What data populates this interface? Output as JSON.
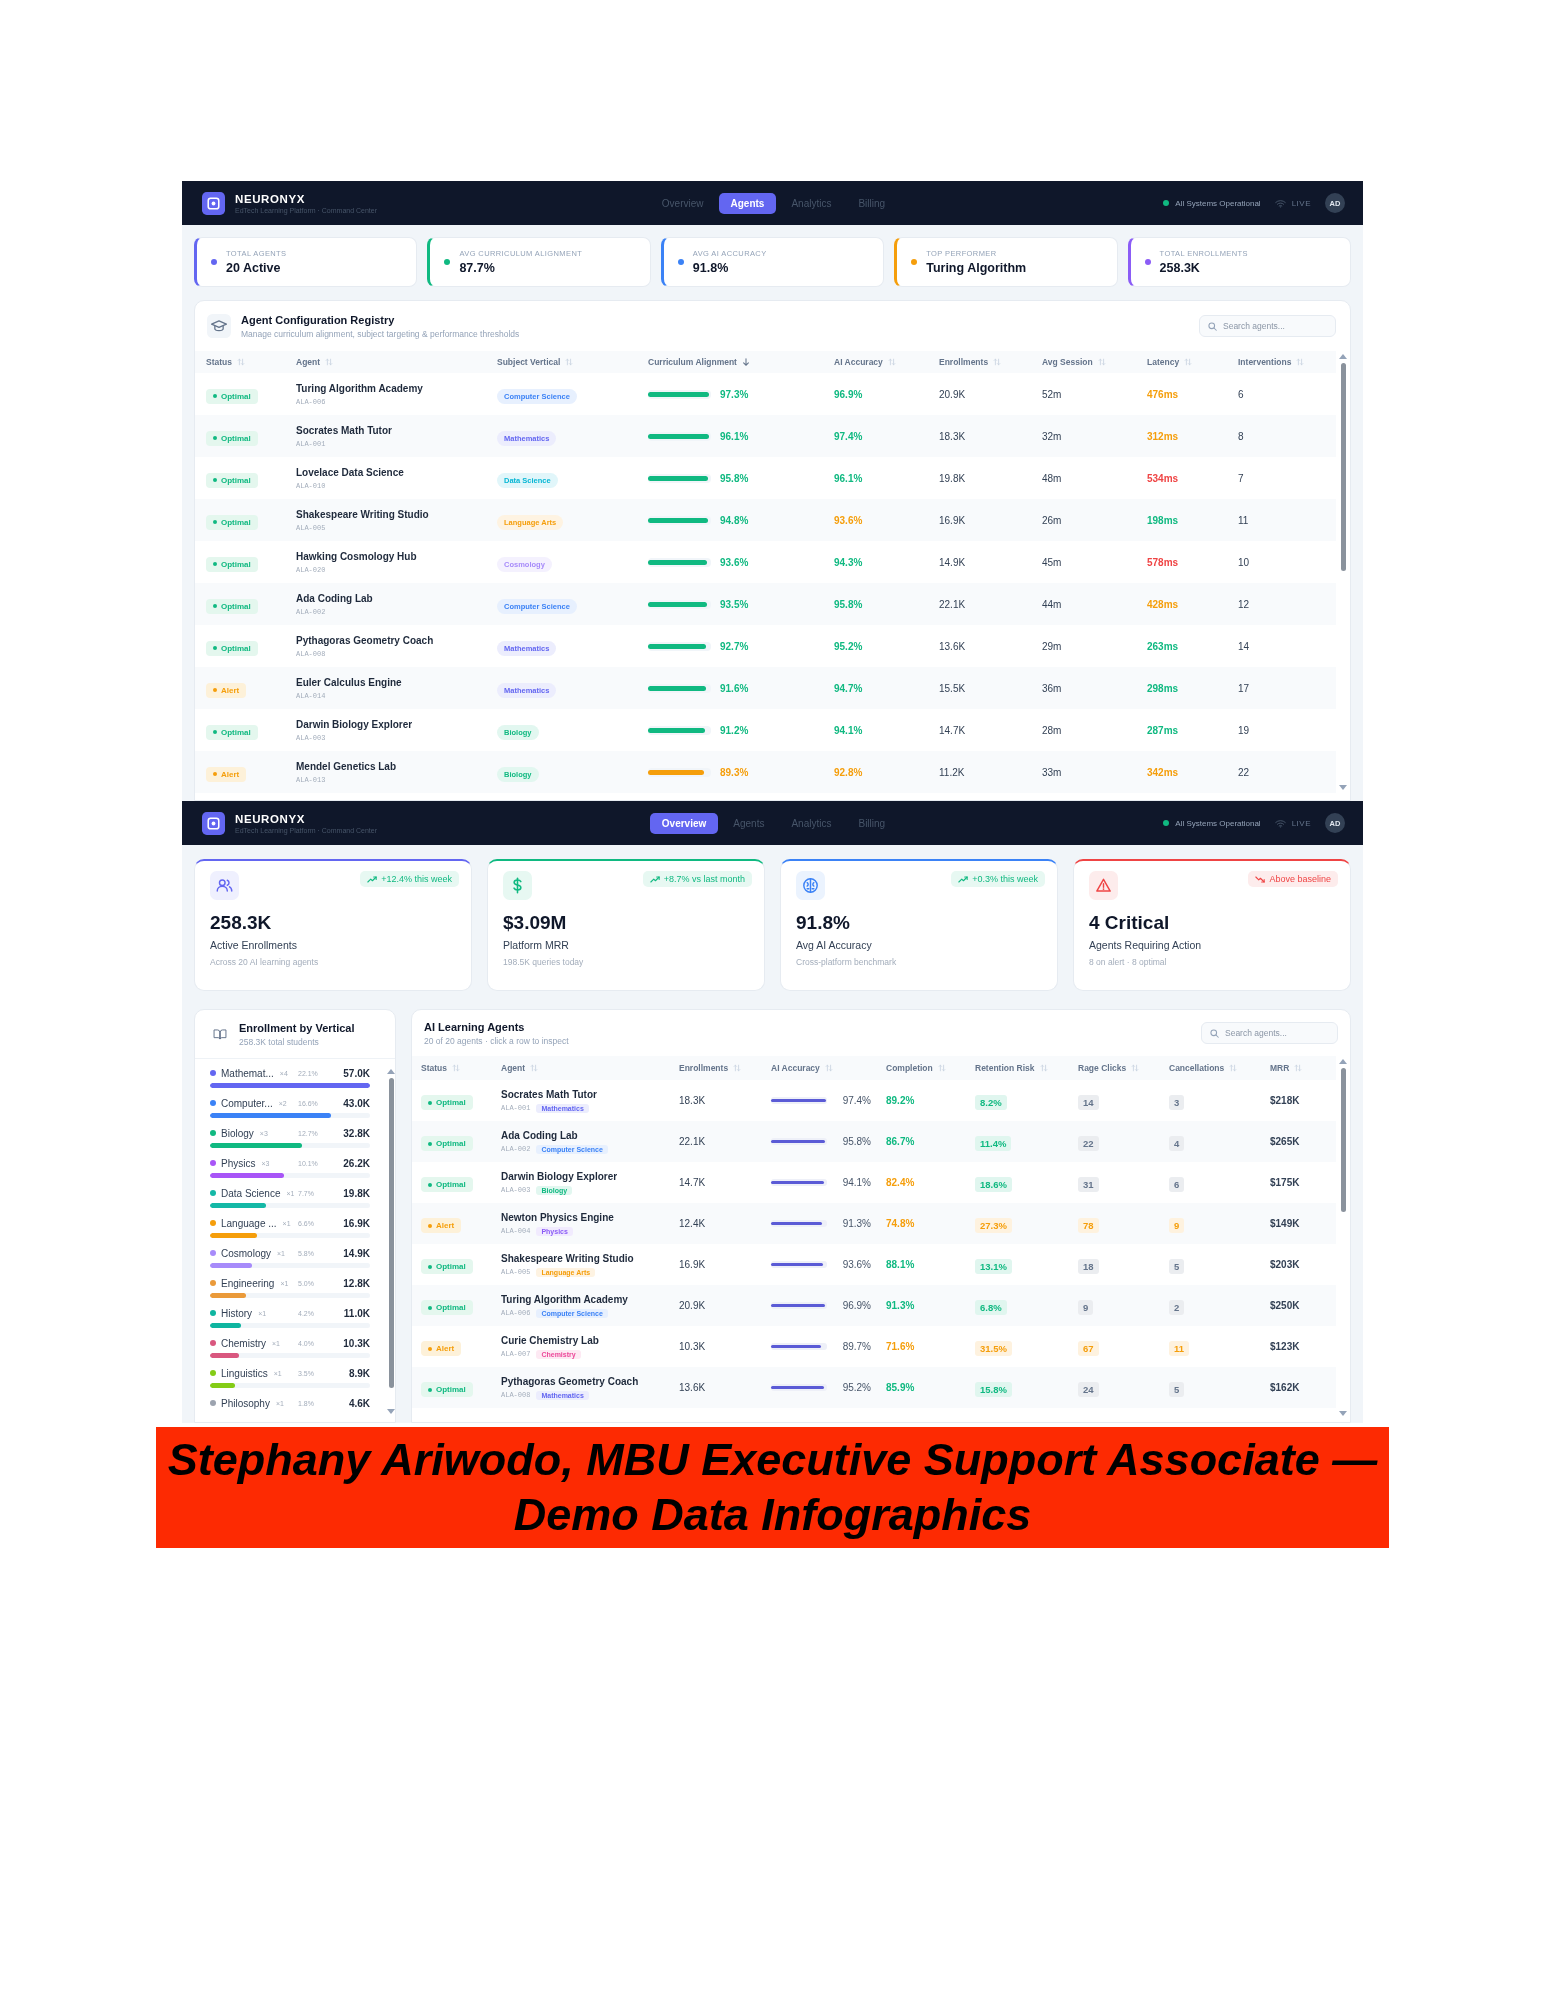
{
  "agents_screen": {
    "header": {
      "brand": "NEURONYX",
      "tagline": "EdTech Learning Platform · Command Center",
      "tabs": [
        {
          "label": "Overview",
          "selected": false
        },
        {
          "label": "Agents",
          "selected": true
        },
        {
          "label": "Analytics",
          "selected": false
        },
        {
          "label": "Billing",
          "selected": false
        }
      ],
      "system_status": "All Systems Operational",
      "live_label": "LIVE",
      "avatar": "AD"
    },
    "stat_cards": [
      {
        "label": "TOTAL AGENTS",
        "value": "20 Active",
        "color": "#6366f1"
      },
      {
        "label": "AVG CURRICULUM ALIGNMENT",
        "value": "87.7%",
        "color": "#10b981"
      },
      {
        "label": "AVG AI ACCURACY",
        "value": "91.8%",
        "color": "#3b82f6"
      },
      {
        "label": "TOP PERFORMER",
        "value": "Turing Algorithm",
        "color": "#f59e0b"
      },
      {
        "label": "TOTAL ENROLLMENTS",
        "value": "258.3K",
        "color": "#8b5cf6"
      }
    ],
    "registry": {
      "title": "Agent Configuration Registry",
      "subtitle": "Manage curriculum alignment, subject targeting & performance thresholds",
      "search": {
        "placeholder": "Search agents..."
      },
      "columns": [
        {
          "label": "Status",
          "sorted": false
        },
        {
          "label": "Agent",
          "sorted": false
        },
        {
          "label": "Subject Vertical",
          "sorted": false
        },
        {
          "label": "Curriculum Alignment",
          "sorted": true
        },
        {
          "label": "AI Accuracy",
          "sorted": false
        },
        {
          "label": "Enrollments",
          "sorted": false
        },
        {
          "label": "Avg Session",
          "sorted": false
        },
        {
          "label": "Latency",
          "sorted": false
        },
        {
          "label": "Interventions",
          "sorted": false
        }
      ],
      "rows": [
        {
          "status": {
            "label": "Optimal",
            "alert": false
          },
          "name": "Turing Algorithm Academy",
          "code": "ALA-006",
          "subject": {
            "label": "Computer Science",
            "color": "#3b82f6"
          },
          "alignment": {
            "value": "97.3%",
            "level": 0.973,
            "color": "#10b981"
          },
          "accuracy": {
            "value": "96.9%",
            "color": "#10b981"
          },
          "enrollments": "20.9K",
          "avg_session": "52m",
          "latency": {
            "value": "476ms",
            "color": "#f59e0b"
          },
          "interventions": "6"
        },
        {
          "status": {
            "label": "Optimal",
            "alert": false
          },
          "name": "Socrates Math Tutor",
          "code": "ALA-001",
          "subject": {
            "label": "Mathematics",
            "color": "#6366f1"
          },
          "alignment": {
            "value": "96.1%",
            "level": 0.961,
            "color": "#10b981"
          },
          "accuracy": {
            "value": "97.4%",
            "color": "#10b981"
          },
          "enrollments": "18.3K",
          "avg_session": "32m",
          "latency": {
            "value": "312ms",
            "color": "#f59e0b"
          },
          "interventions": "8"
        },
        {
          "status": {
            "label": "Optimal",
            "alert": false
          },
          "name": "Lovelace Data Science",
          "code": "ALA-010",
          "subject": {
            "label": "Data Science",
            "color": "#06b6d4"
          },
          "alignment": {
            "value": "95.8%",
            "level": 0.958,
            "color": "#10b981"
          },
          "accuracy": {
            "value": "96.1%",
            "color": "#10b981"
          },
          "enrollments": "19.8K",
          "avg_session": "48m",
          "latency": {
            "value": "534ms",
            "color": "#ef4444"
          },
          "interventions": "7"
        },
        {
          "status": {
            "label": "Optimal",
            "alert": false
          },
          "name": "Shakespeare Writing Studio",
          "code": "ALA-005",
          "subject": {
            "label": "Language Arts",
            "color": "#f59e0b"
          },
          "alignment": {
            "value": "94.8%",
            "level": 0.948,
            "color": "#10b981"
          },
          "accuracy": {
            "value": "93.6%",
            "color": "#f59e0b"
          },
          "enrollments": "16.9K",
          "avg_session": "26m",
          "latency": {
            "value": "198ms",
            "color": "#10b981"
          },
          "interventions": "11"
        },
        {
          "status": {
            "label": "Optimal",
            "alert": false
          },
          "name": "Hawking Cosmology Hub",
          "code": "ALA-020",
          "subject": {
            "label": "Cosmology",
            "color": "#a78bfa"
          },
          "alignment": {
            "value": "93.6%",
            "level": 0.936,
            "color": "#10b981"
          },
          "accuracy": {
            "value": "94.3%",
            "color": "#10b981"
          },
          "enrollments": "14.9K",
          "avg_session": "45m",
          "latency": {
            "value": "578ms",
            "color": "#ef4444"
          },
          "interventions": "10"
        },
        {
          "status": {
            "label": "Optimal",
            "alert": false
          },
          "name": "Ada Coding Lab",
          "code": "ALA-002",
          "subject": {
            "label": "Computer Science",
            "color": "#3b82f6"
          },
          "alignment": {
            "value": "93.5%",
            "level": 0.935,
            "color": "#10b981"
          },
          "accuracy": {
            "value": "95.8%",
            "color": "#10b981"
          },
          "enrollments": "22.1K",
          "avg_session": "44m",
          "latency": {
            "value": "428ms",
            "color": "#f59e0b"
          },
          "interventions": "12"
        },
        {
          "status": {
            "label": "Optimal",
            "alert": false
          },
          "name": "Pythagoras Geometry Coach",
          "code": "ALA-008",
          "subject": {
            "label": "Mathematics",
            "color": "#6366f1"
          },
          "alignment": {
            "value": "92.7%",
            "level": 0.927,
            "color": "#10b981"
          },
          "accuracy": {
            "value": "95.2%",
            "color": "#10b981"
          },
          "enrollments": "13.6K",
          "avg_session": "29m",
          "latency": {
            "value": "263ms",
            "color": "#10b981"
          },
          "interventions": "14"
        },
        {
          "status": {
            "label": "Alert",
            "alert": true
          },
          "name": "Euler Calculus Engine",
          "code": "ALA-014",
          "subject": {
            "label": "Mathematics",
            "color": "#6366f1"
          },
          "alignment": {
            "value": "91.6%",
            "level": 0.916,
            "color": "#10b981"
          },
          "accuracy": {
            "value": "94.7%",
            "color": "#10b981"
          },
          "enrollments": "15.5K",
          "avg_session": "36m",
          "latency": {
            "value": "298ms",
            "color": "#10b981"
          },
          "interventions": "17"
        },
        {
          "status": {
            "label": "Optimal",
            "alert": false
          },
          "name": "Darwin Biology Explorer",
          "code": "ALA-003",
          "subject": {
            "label": "Biology",
            "color": "#10b981"
          },
          "alignment": {
            "value": "91.2%",
            "level": 0.912,
            "color": "#10b981"
          },
          "accuracy": {
            "value": "94.1%",
            "color": "#10b981"
          },
          "enrollments": "14.7K",
          "avg_session": "28m",
          "latency": {
            "value": "287ms",
            "color": "#10b981"
          },
          "interventions": "19"
        },
        {
          "status": {
            "label": "Alert",
            "alert": true
          },
          "name": "Mendel Genetics Lab",
          "code": "ALA-013",
          "subject": {
            "label": "Biology",
            "color": "#10b981"
          },
          "alignment": {
            "value": "89.3%",
            "level": 0.893,
            "color": "#f59e0b"
          },
          "accuracy": {
            "value": "92.8%",
            "color": "#f59e0b"
          },
          "enrollments": "11.2K",
          "avg_session": "33m",
          "latency": {
            "value": "342ms",
            "color": "#f59e0b"
          },
          "interventions": "22"
        }
      ]
    }
  },
  "overview_screen": {
    "header": {
      "brand": "NEURONYX",
      "tagline": "EdTech Learning Platform · Command Center",
      "tabs": [
        {
          "label": "Overview",
          "selected": true
        },
        {
          "label": "Agents",
          "selected": false
        },
        {
          "label": "Analytics",
          "selected": false
        },
        {
          "label": "Billing",
          "selected": false
        }
      ],
      "system_status": "All Systems Operational",
      "live_label": "LIVE",
      "avatar": "AD"
    },
    "kpi_cards": [
      {
        "kind": "enrollments",
        "color": "#6366f1",
        "trend": {
          "text": "+12.4% this week",
          "rising": true
        },
        "value": "258.3K",
        "label": "Active Enrollments",
        "note": "Across 20 AI learning agents"
      },
      {
        "kind": "revenue",
        "color": "#10b981",
        "trend": {
          "text": "+8.7% vs last month",
          "rising": true
        },
        "value": "$3.09M",
        "label": "Platform MRR",
        "note": "198.5K queries today"
      },
      {
        "kind": "accuracy",
        "color": "#3b82f6",
        "trend": {
          "text": "+0.3% this week",
          "rising": true
        },
        "value": "91.8%",
        "label": "Avg AI Accuracy",
        "note": "Cross-platform benchmark"
      },
      {
        "kind": "critical",
        "color": "#ef4444",
        "trend": {
          "text": "Above baseline",
          "rising": false
        },
        "value": "4 Critical",
        "label": "Agents Requiring Action",
        "note": "8 on alert · 8 optimal"
      }
    ],
    "vertical_panel": {
      "title": "Enrollment by Vertical",
      "subtitle": "258.3K total students",
      "items": [
        {
          "name": "Mathemat...",
          "count": "×4",
          "share": "22.1%",
          "value": "57.0K",
          "level": 1.0,
          "color": "#6366f1"
        },
        {
          "name": "Computer...",
          "count": "×2",
          "share": "16.6%",
          "value": "43.0K",
          "level": 0.754,
          "color": "#3b82f6"
        },
        {
          "name": "Biology",
          "count": "×3",
          "share": "12.7%",
          "value": "32.8K",
          "level": 0.575,
          "color": "#10b981"
        },
        {
          "name": "Physics",
          "count": "×3",
          "share": "10.1%",
          "value": "26.2K",
          "level": 0.46,
          "color": "#a855f7"
        },
        {
          "name": "Data Science",
          "count": "×1",
          "share": "7.7%",
          "value": "19.8K",
          "level": 0.347,
          "color": "#14b8a6"
        },
        {
          "name": "Language ...",
          "count": "×1",
          "share": "6.6%",
          "value": "16.9K",
          "level": 0.296,
          "color": "#f59e0b"
        },
        {
          "name": "Cosmology",
          "count": "×1",
          "share": "5.8%",
          "value": "14.9K",
          "level": 0.261,
          "color": "#a78bfa"
        },
        {
          "name": "Engineering",
          "count": "×1",
          "share": "5.0%",
          "value": "12.8K",
          "level": 0.225,
          "color": "#ea9a3a"
        },
        {
          "name": "History",
          "count": "×1",
          "share": "4.2%",
          "value": "11.0K",
          "level": 0.193,
          "color": "#0fb5a0"
        },
        {
          "name": "Chemistry",
          "count": "×1",
          "share": "4.0%",
          "value": "10.3K",
          "level": 0.181,
          "color": "#d9577f"
        },
        {
          "name": "Linguistics",
          "count": "×1",
          "share": "3.5%",
          "value": "8.9K",
          "level": 0.156,
          "color": "#84cc16"
        },
        {
          "name": "Philosophy",
          "count": "×1",
          "share": "1.8%",
          "value": "4.6K",
          "color": "#9ca3af"
        }
      ]
    },
    "agents_table": {
      "title": "AI Learning Agents",
      "subtitle": "20 of 20 agents · click a row to inspect",
      "search": {
        "placeholder": "Search agents..."
      },
      "columns": [
        {
          "label": "Status",
          "sorted": false
        },
        {
          "label": "Agent",
          "sorted": false
        },
        {
          "label": "Enrollments",
          "sorted": false
        },
        {
          "label": "AI Accuracy",
          "sorted": false
        },
        {
          "label": "Completion",
          "sorted": false
        },
        {
          "label": "Retention Risk",
          "sorted": false
        },
        {
          "label": "Rage Clicks",
          "sorted": false
        },
        {
          "label": "Cancellations",
          "sorted": false
        },
        {
          "label": "MRR",
          "sorted": false
        }
      ],
      "rows": [
        {
          "status": {
            "label": "Optimal",
            "alert": false
          },
          "name": "Socrates Math Tutor",
          "code": "ALA-001",
          "subject": {
            "label": "Mathematics",
            "color": "#6366f1"
          },
          "enrollments": "18.3K",
          "accuracy": {
            "value": "97.4%",
            "level": 0.974
          },
          "completion": {
            "value": "89.2%",
            "color": "#10b981"
          },
          "retention_risk": {
            "value": "8.2%",
            "color": "#10b981"
          },
          "rage_clicks": {
            "value": "14",
            "color": "#64748b"
          },
          "cancellations": {
            "value": "3",
            "color": "#64748b"
          },
          "mrr": "$218K"
        },
        {
          "status": {
            "label": "Optimal",
            "alert": false
          },
          "name": "Ada Coding Lab",
          "code": "ALA-002",
          "subject": {
            "label": "Computer Science",
            "color": "#3b82f6"
          },
          "enrollments": "22.1K",
          "accuracy": {
            "value": "95.8%",
            "level": 0.958
          },
          "completion": {
            "value": "86.7%",
            "color": "#10b981"
          },
          "retention_risk": {
            "value": "11.4%",
            "color": "#10b981"
          },
          "rage_clicks": {
            "value": "22",
            "color": "#64748b"
          },
          "cancellations": {
            "value": "4",
            "color": "#64748b"
          },
          "mrr": "$265K"
        },
        {
          "status": {
            "label": "Optimal",
            "alert": false
          },
          "name": "Darwin Biology Explorer",
          "code": "ALA-003",
          "subject": {
            "label": "Biology",
            "color": "#10b981"
          },
          "enrollments": "14.7K",
          "accuracy": {
            "value": "94.1%",
            "level": 0.941
          },
          "completion": {
            "value": "82.4%",
            "color": "#f59e0b"
          },
          "retention_risk": {
            "value": "18.6%",
            "color": "#10b981"
          },
          "rage_clicks": {
            "value": "31",
            "color": "#64748b"
          },
          "cancellations": {
            "value": "6",
            "color": "#64748b"
          },
          "mrr": "$175K"
        },
        {
          "status": {
            "label": "Alert",
            "alert": true
          },
          "name": "Newton Physics Engine",
          "code": "ALA-004",
          "subject": {
            "label": "Physics",
            "color": "#8b5cf6"
          },
          "enrollments": "12.4K",
          "accuracy": {
            "value": "91.3%",
            "level": 0.913
          },
          "completion": {
            "value": "74.8%",
            "color": "#f59e0b"
          },
          "retention_risk": {
            "value": "27.3%",
            "color": "#f59e0b"
          },
          "rage_clicks": {
            "value": "78",
            "color": "#f59e0b"
          },
          "cancellations": {
            "value": "9",
            "color": "#f59e0b"
          },
          "mrr": "$149K"
        },
        {
          "status": {
            "label": "Optimal",
            "alert": false
          },
          "name": "Shakespeare Writing Studio",
          "code": "ALA-005",
          "subject": {
            "label": "Language Arts",
            "color": "#f59e0b"
          },
          "enrollments": "16.9K",
          "accuracy": {
            "value": "93.6%",
            "level": 0.936
          },
          "completion": {
            "value": "88.1%",
            "color": "#10b981"
          },
          "retention_risk": {
            "value": "13.1%",
            "color": "#10b981"
          },
          "rage_clicks": {
            "value": "18",
            "color": "#64748b"
          },
          "cancellations": {
            "value": "5",
            "color": "#64748b"
          },
          "mrr": "$203K"
        },
        {
          "status": {
            "label": "Optimal",
            "alert": false
          },
          "name": "Turing Algorithm Academy",
          "code": "ALA-006",
          "subject": {
            "label": "Computer Science",
            "color": "#3b82f6"
          },
          "enrollments": "20.9K",
          "accuracy": {
            "value": "96.9%",
            "level": 0.969
          },
          "completion": {
            "value": "91.3%",
            "color": "#10b981"
          },
          "retention_risk": {
            "value": "6.8%",
            "color": "#10b981"
          },
          "rage_clicks": {
            "value": "9",
            "color": "#64748b"
          },
          "cancellations": {
            "value": "2",
            "color": "#64748b"
          },
          "mrr": "$250K"
        },
        {
          "status": {
            "label": "Alert",
            "alert": true
          },
          "name": "Curie Chemistry Lab",
          "code": "ALA-007",
          "subject": {
            "label": "Chemistry",
            "color": "#ec4899"
          },
          "enrollments": "10.3K",
          "accuracy": {
            "value": "89.7%",
            "level": 0.897
          },
          "completion": {
            "value": "71.6%",
            "color": "#f59e0b"
          },
          "retention_risk": {
            "value": "31.5%",
            "color": "#f59e0b"
          },
          "rage_clicks": {
            "value": "67",
            "color": "#f59e0b"
          },
          "cancellations": {
            "value": "11",
            "color": "#f59e0b"
          },
          "mrr": "$123K"
        },
        {
          "status": {
            "label": "Optimal",
            "alert": false
          },
          "name": "Pythagoras Geometry Coach",
          "code": "ALA-008",
          "subject": {
            "label": "Mathematics",
            "color": "#6366f1"
          },
          "enrollments": "13.6K",
          "accuracy": {
            "value": "95.2%",
            "level": 0.952
          },
          "completion": {
            "value": "85.9%",
            "color": "#10b981"
          },
          "retention_risk": {
            "value": "15.8%",
            "color": "#10b981"
          },
          "rage_clicks": {
            "value": "24",
            "color": "#64748b"
          },
          "cancellations": {
            "value": "5",
            "color": "#64748b"
          },
          "mrr": "$162K"
        }
      ]
    }
  },
  "caption_banner": {
    "text": "Stephany Ariwodo, MBU Executive Support Associate — Demo Data Infographics"
  }
}
